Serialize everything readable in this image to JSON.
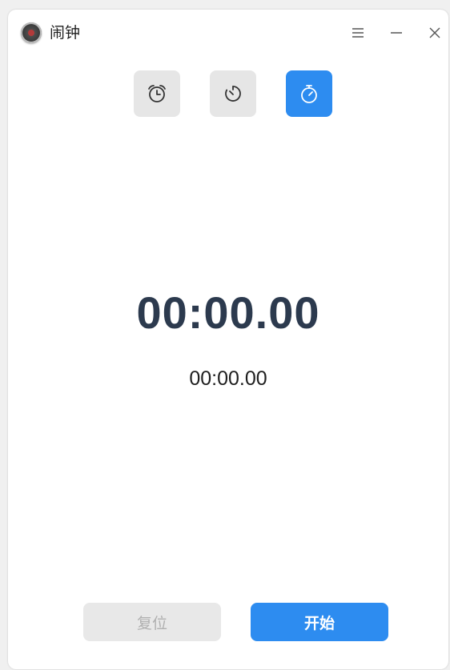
{
  "window": {
    "title": "闹钟"
  },
  "tabs": [
    {
      "id": "alarm",
      "icon": "alarm-clock-icon",
      "active": false
    },
    {
      "id": "timer",
      "icon": "timer-icon",
      "active": false
    },
    {
      "id": "stopwatch",
      "icon": "stopwatch-icon",
      "active": true
    }
  ],
  "stopwatch": {
    "main_time": "00:00.00",
    "lap_time": "00:00.00"
  },
  "buttons": {
    "reset_label": "复位",
    "start_label": "开始"
  },
  "colors": {
    "accent": "#2d8cf0",
    "time_text": "#2c3a4e",
    "tab_inactive": "#e6e6e6",
    "button_disabled_bg": "#e8e8e8",
    "button_disabled_text": "#b0b0b0"
  }
}
